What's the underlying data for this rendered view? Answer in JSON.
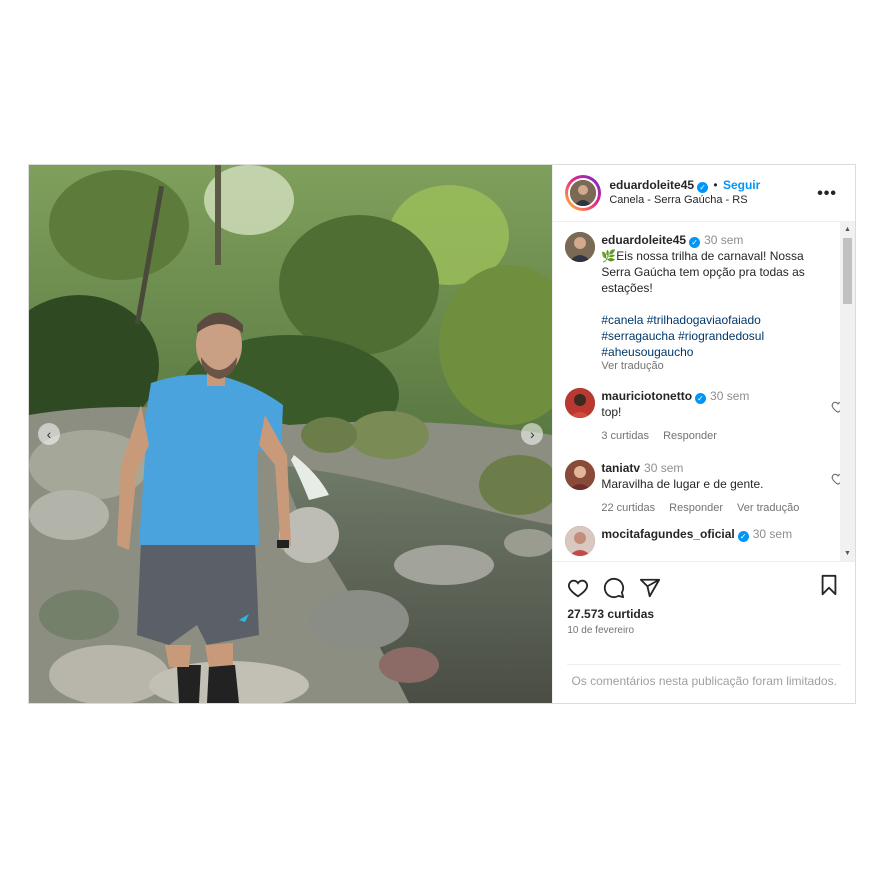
{
  "header": {
    "username": "eduardoleite45",
    "separator": "•",
    "follow_label": "Seguir",
    "location": "Canela - Serra Gaúcha - RS",
    "more_label": "•••"
  },
  "caption": {
    "username": "eduardoleite45",
    "time": "30 sem",
    "text": "🌿Eis nossa trilha de carnaval! Nossa Serra Gaúcha tem opção pra todas as estações!",
    "hashtags": "#canela #trilhadogaviaofaiado #serragaucha #riograndedosul #aheusougaucho",
    "translate": "Ver tradução"
  },
  "comments": [
    {
      "username": "mauriciotonetto",
      "time": "30 sem",
      "text": "top!",
      "likes": "3 curtidas",
      "reply": "Responder"
    },
    {
      "username": "taniatv",
      "time": "30 sem",
      "text": "Maravilha de lugar e de gente.",
      "likes": "22 curtidas",
      "reply": "Responder",
      "translate": "Ver tradução"
    },
    {
      "username": "mocitafagundes_oficial",
      "time": "30 sem"
    }
  ],
  "stats": {
    "likes": "27.573 curtidas",
    "date": "10 de fevereiro"
  },
  "footer": {
    "limited": "Os comentários nesta publicação foram limitados."
  },
  "icons": {
    "like": "heart-icon",
    "comment": "comment-icon",
    "share": "share-icon",
    "save": "bookmark-icon",
    "verified": "verified-badge-icon"
  },
  "colors": {
    "accent": "#0095f6",
    "hashtag": "#00376b",
    "muted": "#737373"
  }
}
